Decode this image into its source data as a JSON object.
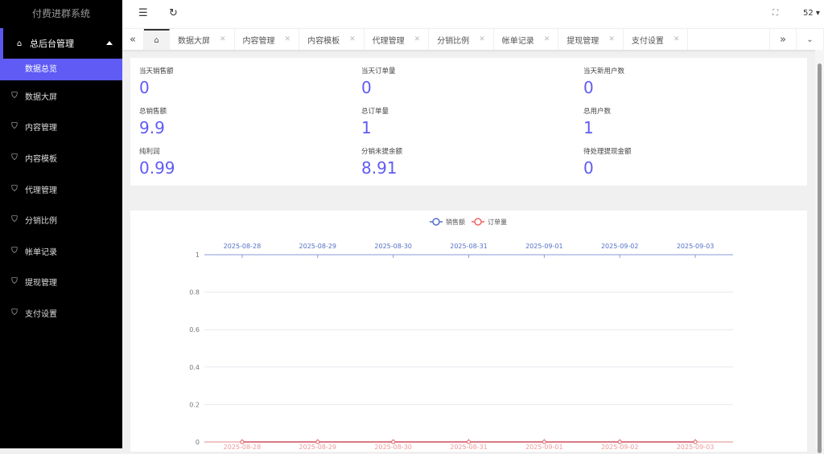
{
  "app_title": "付费进群系统",
  "sidebar": {
    "parent": "总后台管理",
    "active": "数据总览",
    "items": [
      "数据大屏",
      "内容管理",
      "内容模板",
      "代理管理",
      "分销比例",
      "帐单记录",
      "提现管理",
      "支付设置"
    ]
  },
  "header": {
    "user": "52"
  },
  "tabs": [
    "数据大屏",
    "内容管理",
    "内容模板",
    "代理管理",
    "分销比例",
    "帐单记录",
    "提现管理",
    "支付设置"
  ],
  "stats": [
    {
      "label": "当天销售额",
      "value": "0"
    },
    {
      "label": "当天订单量",
      "value": "0"
    },
    {
      "label": "当天新用户数",
      "value": "0"
    },
    {
      "label": "总销售额",
      "value": "9.9"
    },
    {
      "label": "总订单量",
      "value": "1"
    },
    {
      "label": "总用户数",
      "value": "1"
    },
    {
      "label": "纯利润",
      "value": "0.99"
    },
    {
      "label": "分销未提余额",
      "value": "8.91"
    },
    {
      "label": "待处理提现金额",
      "value": "0"
    }
  ],
  "chart_data": {
    "type": "line",
    "categories": [
      "2025-08-28",
      "2025-08-29",
      "2025-08-30",
      "2025-08-31",
      "2025-09-01",
      "2025-09-02",
      "2025-09-03"
    ],
    "series": [
      {
        "name": "销售额",
        "color": "#5470c6",
        "values": [
          0,
          0,
          0,
          0,
          0,
          0,
          0
        ]
      },
      {
        "name": "订单量",
        "color": "#ee6666",
        "values": [
          0,
          0,
          0,
          0,
          0,
          0,
          0
        ]
      }
    ],
    "ylim": [
      0,
      1
    ],
    "yticks": [
      "0",
      "0.2",
      "0.4",
      "0.6",
      "0.8",
      "1"
    ],
    "legend": "top-center",
    "grid": true
  }
}
